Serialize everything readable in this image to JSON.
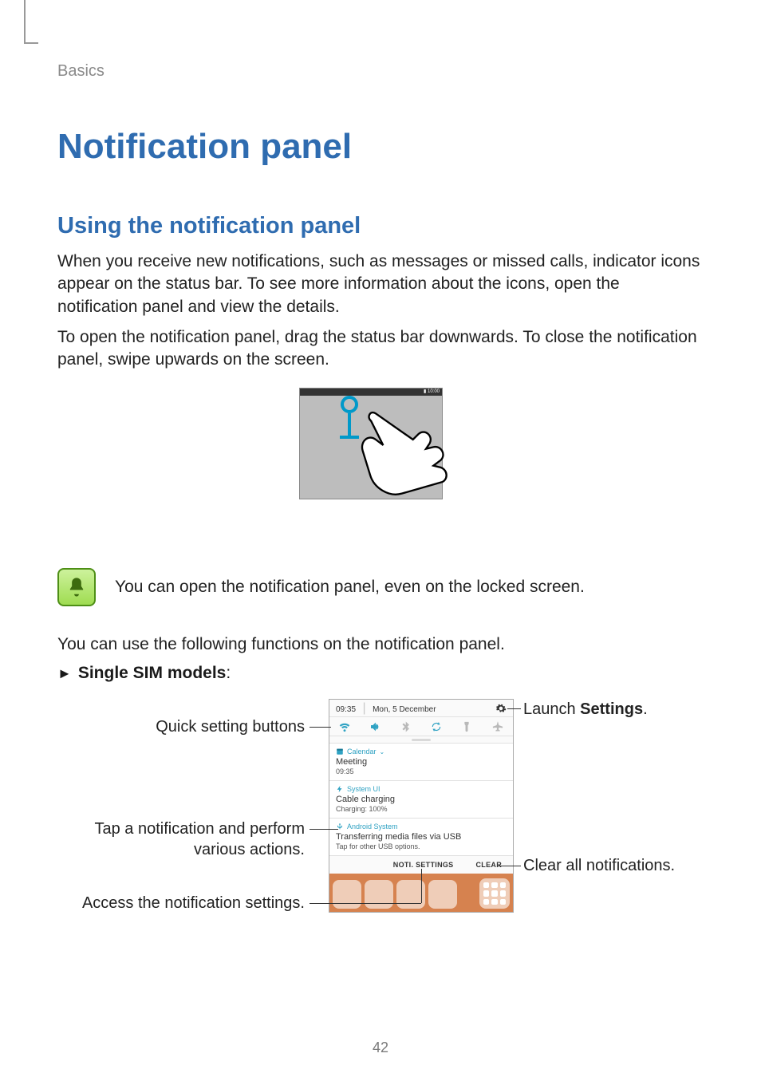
{
  "breadcrumb": "Basics",
  "h1": "Notification panel",
  "h2": "Using the notification panel",
  "para1": "When you receive new notifications, such as messages or missed calls, indicator icons appear on the status bar. To see more information about the icons, open the notification panel and view the details.",
  "para2": "To open the notification panel, drag the status bar downwards. To close the notification panel, swipe upwards on the screen.",
  "drag": {
    "statusbar_time": "10:00"
  },
  "note_text": "You can open the notification panel, even on the locked screen.",
  "functions_intro": "You can use the following functions on the notification panel.",
  "bullet": {
    "arrow": "►",
    "label": "Single SIM models",
    "colon": ":"
  },
  "phone": {
    "time": "09:35",
    "date": "Mon, 5 December",
    "quick_icons": [
      "wifi",
      "sound",
      "bluetooth",
      "rotate",
      "flashlight",
      "airplane"
    ],
    "cards": [
      {
        "icon": "calendar",
        "app": "Calendar",
        "chevron": "⌄",
        "title": "Meeting",
        "sub": "09:35"
      },
      {
        "icon": "bolt",
        "app": "System UI",
        "title": "Cable charging",
        "sub": "Charging: 100%"
      },
      {
        "icon": "usb",
        "app": "Android System",
        "title": "Transferring media files via USB",
        "sub": "Tap for other USB options."
      }
    ],
    "footer": {
      "noti": "NOTI. SETTINGS",
      "clear": "CLEAR"
    }
  },
  "callouts": {
    "left1": "Quick setting buttons",
    "left2a": "Tap a notification and perform",
    "left2b": "various actions.",
    "left3": "Access the notification settings.",
    "right1a": "Launch ",
    "right1b": "Settings",
    "right1c": ".",
    "right2": "Clear all notifications."
  },
  "page_number": "42"
}
